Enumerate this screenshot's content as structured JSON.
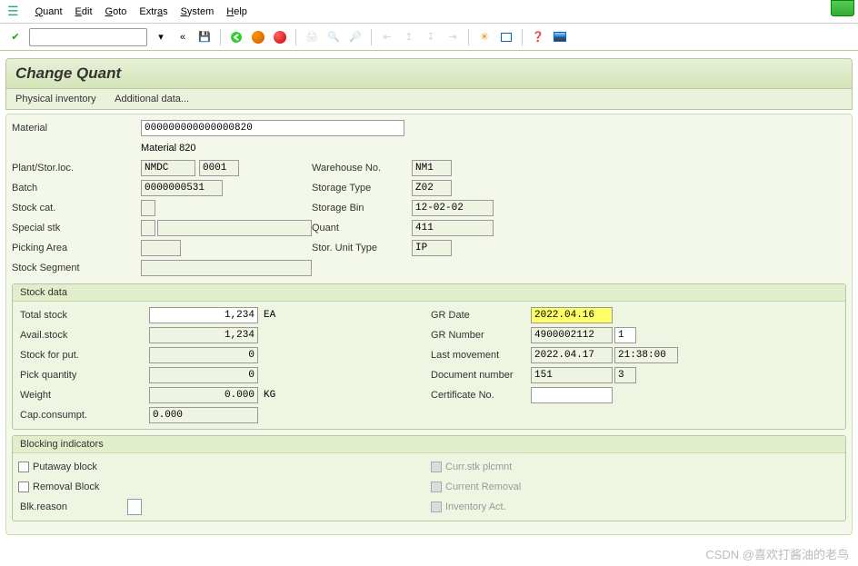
{
  "menu": {
    "m1_pre": "Q",
    "m1_rest": "uant",
    "m2_pre": "E",
    "m2_rest": "dit",
    "m3_pre": "G",
    "m3_rest": "oto",
    "m4": "Extr",
    "m4_u": "a",
    "m4_rest": "s",
    "m5_pre": "S",
    "m5_rest": "ystem",
    "m6_pre": "H",
    "m6_rest": "elp"
  },
  "title": "Change Quant",
  "subtabs": {
    "t1": "Physical inventory",
    "t2": "Additional data..."
  },
  "labels": {
    "material": "Material",
    "material_desc": "Material 820",
    "plant": "Plant/Stor.loc.",
    "batch": "Batch",
    "stockcat": "Stock cat.",
    "specstk": "Special stk",
    "pickarea": "Picking Area",
    "stockseg": "Stock Segment",
    "wh": "Warehouse No.",
    "stype": "Storage Type",
    "sbin": "Storage Bin",
    "quant": "Quant",
    "sutype": "Stor. Unit Type",
    "stockdata": "Stock data",
    "totalstock": "Total stock",
    "availstock": "Avail.stock",
    "stockput": "Stock for put.",
    "pickqty": "Pick quantity",
    "weight": "Weight",
    "capcons": "Cap.consumpt.",
    "grdate": "GR Date",
    "grnum": "GR Number",
    "lastmov": "Last movement",
    "docnum": "Document number",
    "certno": "Certificate No.",
    "ea": "EA",
    "kg": "KG",
    "blocking": "Blocking indicators",
    "putaway": "Putaway block",
    "removal": "Removal Block",
    "blkreason": "Blk.reason",
    "currstk": "Curr.stk plcmnt",
    "currrem": "Current Removal",
    "invact": "Inventory Act."
  },
  "values": {
    "material": "000000000000000820",
    "plant": "NMDC",
    "sloc": "0001",
    "batch": "0000000531",
    "specstk": "",
    "wh": "NM1",
    "stype": "Z02",
    "sbin": "12-02-02",
    "quant": "411",
    "sutype": "IP",
    "totalstock": "1,234",
    "availstock": "1,234",
    "stockput": "0",
    "pickqty": "0",
    "weight": "0.000",
    "capcons": "0.000",
    "grdate": "2022.04.16",
    "grnum": "4900002112",
    "grnum2": "1",
    "lastmov_d": "2022.04.17",
    "lastmov_t": "21:38:00",
    "docnum": "151",
    "docnum2": "3",
    "certno": ""
  },
  "watermark": "CSDN @喜欢打酱油的老鸟"
}
